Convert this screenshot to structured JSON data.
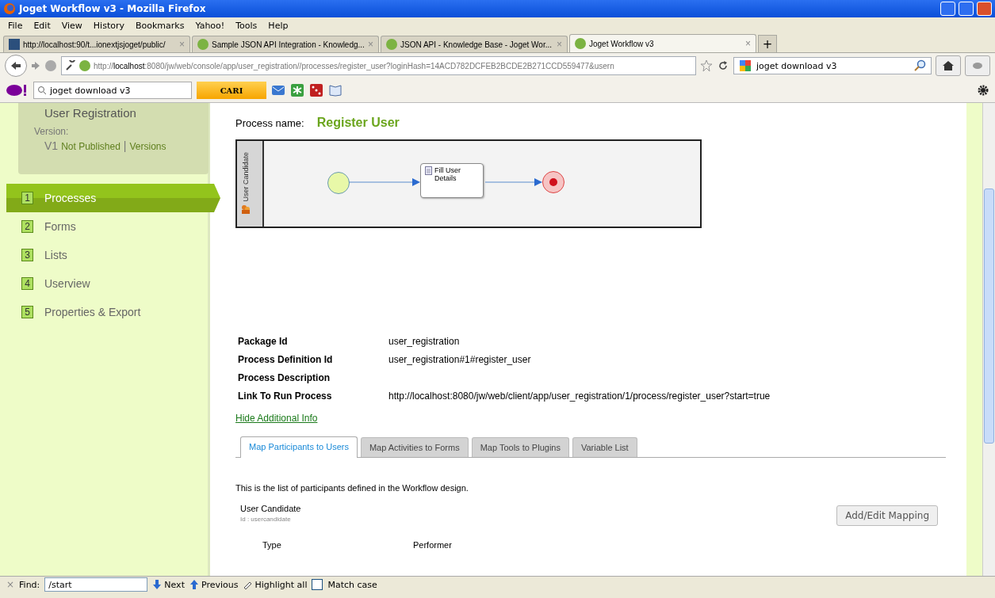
{
  "window": {
    "title": "Joget Workflow v3 - Mozilla Firefox"
  },
  "menu": [
    "File",
    "Edit",
    "View",
    "History",
    "Bookmarks",
    "Yahoo!",
    "Tools",
    "Help"
  ],
  "browser_tabs": [
    {
      "title": "http://localhost:90/t...ionextjsjoget/public/",
      "selected": false
    },
    {
      "title": "Sample JSON API Integration - Knowledg...",
      "selected": false
    },
    {
      "title": "JSON API - Knowledge Base - Joget Wor...",
      "selected": false
    },
    {
      "title": "Joget Workflow v3",
      "selected": true
    }
  ],
  "tab_close": "×",
  "new_tab": "+",
  "address_bar": {
    "url": "http://**localhost**:8080/jw/web/console/app/user_registration//processes/register_user?loginHash=14ACD782DCFEB2BCDE2B271CCD559477&usern"
  },
  "search_box": {
    "value": "joget download v3"
  },
  "yahoo_toolbar": {
    "search_value": "joget download v3",
    "search_button": "CARI"
  },
  "sidebar": {
    "app_name": "User Registration",
    "version_label": "Version:",
    "version": "V1",
    "status": "Not Published",
    "separator": "|",
    "versions_link": "Versions",
    "items": [
      {
        "number": "1",
        "label": "Processes",
        "selected": true
      },
      {
        "number": "2",
        "label": "Forms",
        "selected": false
      },
      {
        "number": "3",
        "label": "Lists",
        "selected": false
      },
      {
        "number": "4",
        "label": "Userview",
        "selected": false
      },
      {
        "number": "5",
        "label": "Properties & Export",
        "selected": false
      }
    ]
  },
  "process": {
    "name_label": "Process name:",
    "name": "Register User",
    "diagram": {
      "lane": "User Candidate",
      "activity": "Fill User Details"
    }
  },
  "details": [
    {
      "label": "Package Id",
      "value": "user_registration"
    },
    {
      "label": "Process Definition Id",
      "value": "user_registration#1#register_user"
    },
    {
      "label": "Process Description"
    },
    {
      "label": "Link To Run Process",
      "value": "http://localhost:8080/jw/web/client/app/user_registration/1/process/register_user?start=true"
    }
  ],
  "hide_link": "Hide Additional Info",
  "tabs": [
    {
      "label": "Map Participants to Users",
      "selected": true
    },
    {
      "label": "Map Activities to Forms",
      "selected": false
    },
    {
      "label": "Map Tools to Plugins",
      "selected": false
    },
    {
      "label": "Variable List",
      "selected": false
    }
  ],
  "tab_content": {
    "intro": "This is the list of participants defined in the Workflow design.",
    "participant": {
      "name": "User Candidate",
      "id": "Id : usercandidate"
    },
    "button": "Add/Edit Mapping",
    "columns": [
      "Type",
      "Performer"
    ]
  },
  "find_bar": {
    "close": "×",
    "label": "Find:",
    "value": "/start",
    "next": "Next",
    "previous": "Previous",
    "highlight": "Highlight all",
    "match_case": {
      "label": "Match case",
      "checked": false
    }
  }
}
